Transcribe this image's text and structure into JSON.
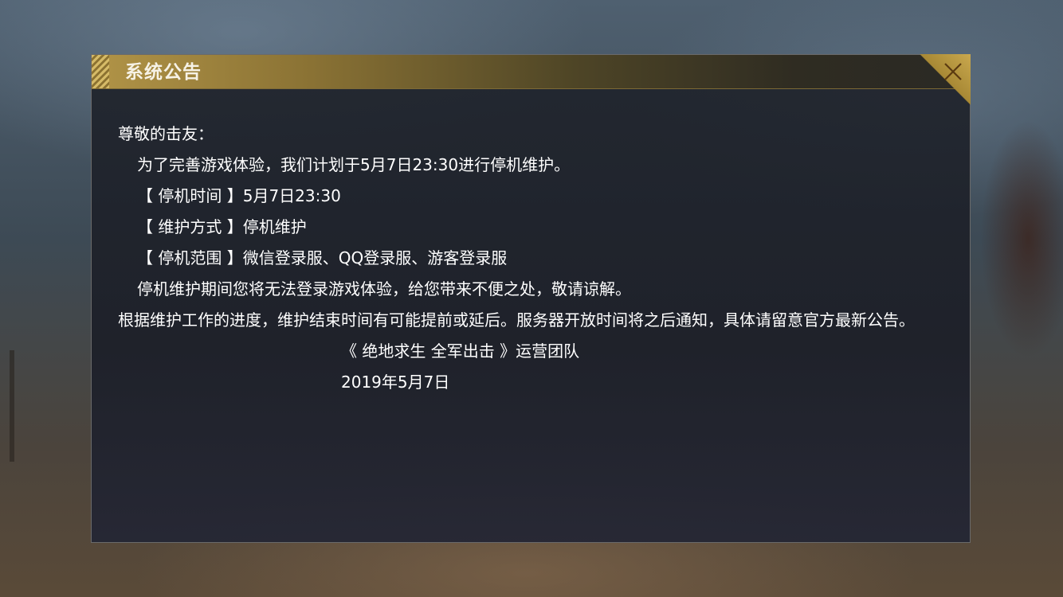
{
  "dialog": {
    "title": "系统公告",
    "close_icon": "close-icon"
  },
  "announcement": {
    "greeting": "尊敬的击友：",
    "intro": "为了完善游戏体验，我们计划于5月7日23:30进行停机维护。",
    "downtime": "【 停机时间 】5月7日23:30",
    "method": "【 维护方式 】停机维护",
    "scope": "【 停机范围 】微信登录服、QQ登录服、游客登录服",
    "apology": "停机维护期间您将无法登录游戏体验，给您带来不便之处，敬请谅解。",
    "note": "根据维护工作的进度，维护结束时间有可能提前或延后。服务器开放时间将之后通知，具体请留意官方最新公告。",
    "signature": "《 绝地求生 全军出击 》运营团队",
    "date": "2019年5月7日"
  },
  "colors": {
    "title_gold": "#b19447",
    "panel_bg": "#1f232c",
    "text": "#ffffff"
  }
}
